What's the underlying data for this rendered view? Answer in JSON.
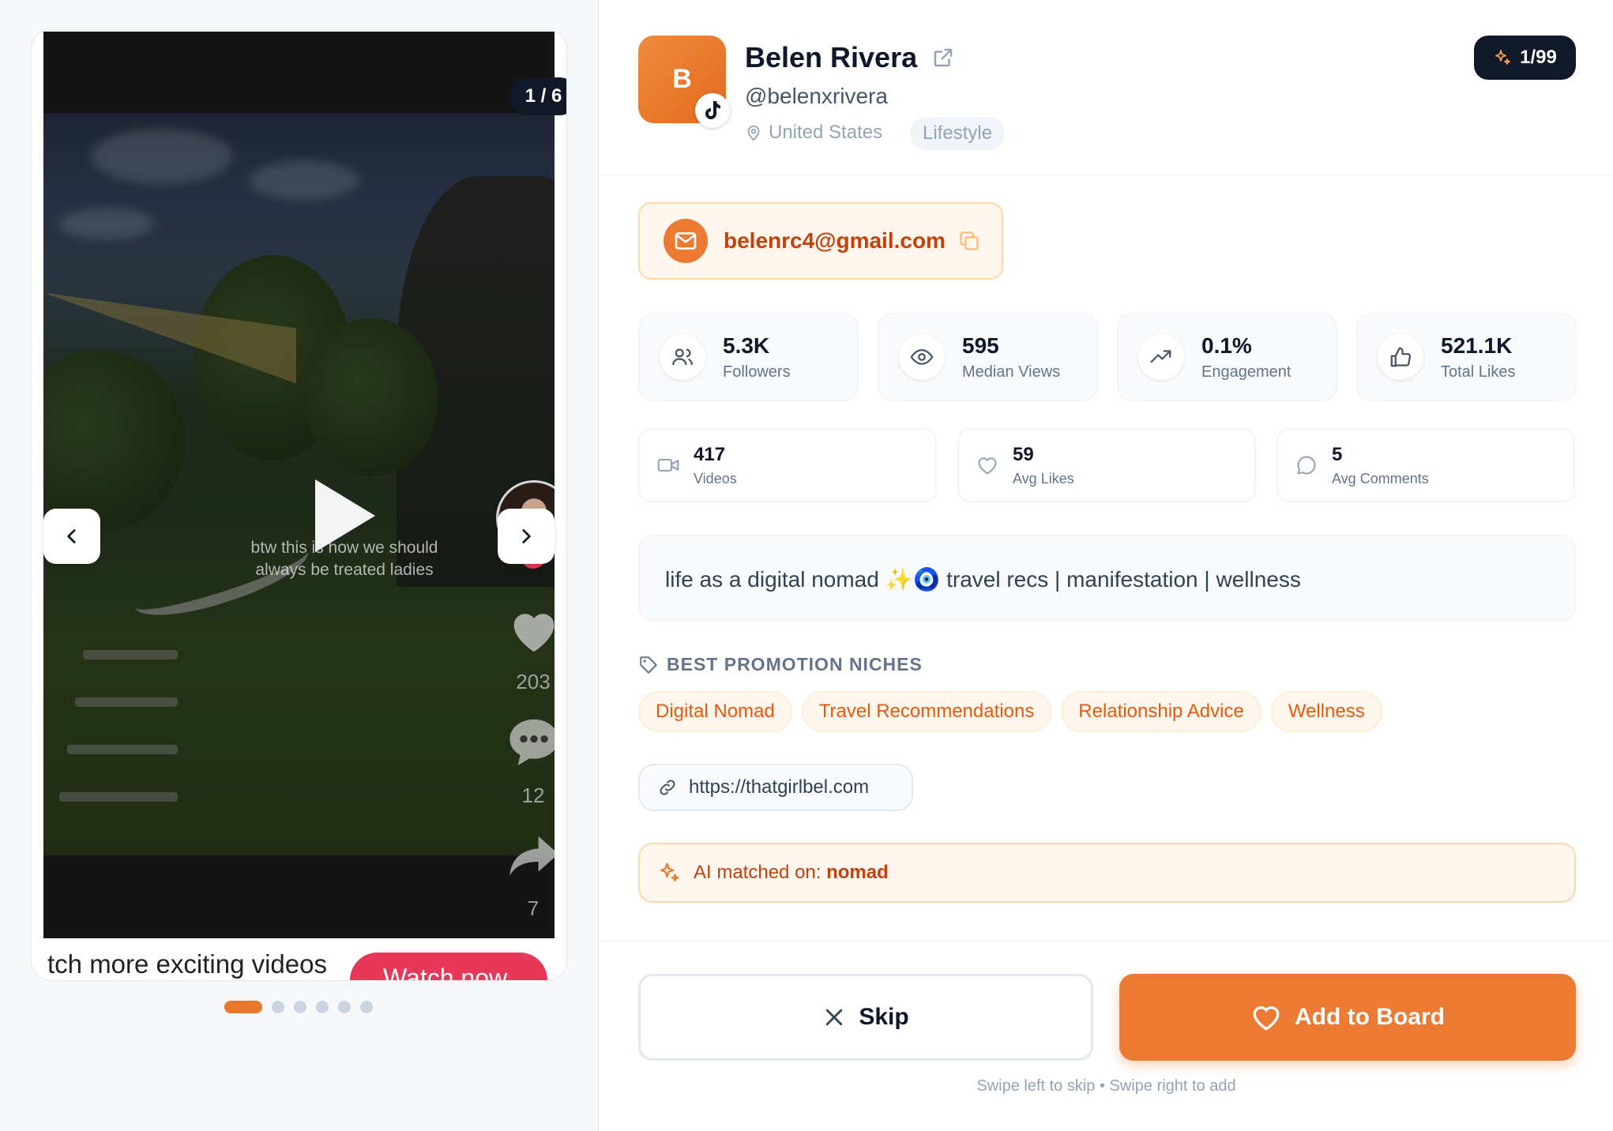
{
  "media": {
    "counter": "1 / 6",
    "caption": "btw this is how we should always be treated ladies",
    "likes": "203",
    "comments": "12",
    "shares": "7",
    "banner_text": "tch more exciting videos",
    "watch_now": "Watch now",
    "total_slides": 6,
    "active_slide": 1
  },
  "profile": {
    "avatar_initial": "B",
    "name": "Belen Rivera",
    "handle": "@belenxrivera",
    "location": "United States",
    "category": "Lifestyle",
    "rank": "1/99"
  },
  "contact": {
    "email": "belenrc4@gmail.com"
  },
  "stats": [
    {
      "value": "5.3K",
      "label": "Followers",
      "icon": "users-icon"
    },
    {
      "value": "595",
      "label": "Median Views",
      "icon": "eye-icon"
    },
    {
      "value": "0.1%",
      "label": "Engagement",
      "icon": "trending-up-icon"
    },
    {
      "value": "521.1K",
      "label": "Total Likes",
      "icon": "thumbs-up-icon"
    }
  ],
  "secondary_stats": [
    {
      "value": "417",
      "label": "Videos",
      "icon": "video-icon"
    },
    {
      "value": "59",
      "label": "Avg Likes",
      "icon": "heart-icon"
    },
    {
      "value": "5",
      "label": "Avg Comments",
      "icon": "comment-icon"
    }
  ],
  "bio": "life as a digital nomad ✨🧿 travel recs | manifestation | wellness",
  "niches": {
    "title": "BEST PROMOTION NICHES",
    "items": [
      "Digital Nomad",
      "Travel Recommendations",
      "Relationship Advice",
      "Wellness"
    ]
  },
  "website": "https://thatgirlbel.com",
  "ai_match": {
    "label": "AI matched on: ",
    "keyword": "nomad"
  },
  "actions": {
    "skip": "Skip",
    "add": "Add to Board",
    "hint": "Swipe left to skip • Swipe right to add"
  },
  "colors": {
    "accent": "#ec7a32",
    "dark": "#111827"
  }
}
